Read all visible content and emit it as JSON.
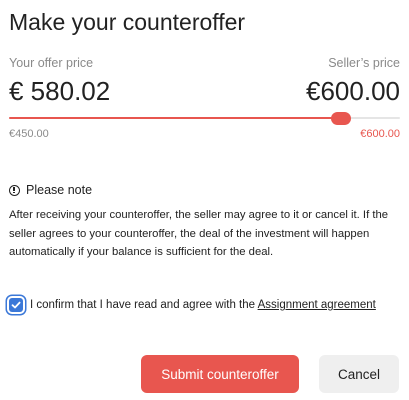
{
  "dialog": {
    "title": "Make your counteroffer"
  },
  "offer": {
    "your_label": "Your offer price",
    "your_value": "€ 580.02",
    "seller_label": "Seller’s price",
    "seller_value": "€600.00"
  },
  "slider": {
    "min_label": "€450.00",
    "max_label": "€600.00",
    "min": 450.0,
    "max": 600.0,
    "value": 580.02,
    "accent_color": "#e8564f"
  },
  "note": {
    "icon": "info-icon",
    "heading": "Please note",
    "text": "After receiving your counteroffer, the seller may agree to it or cancel it. If the seller agrees to your counteroffer, the deal of the investment will happen automatically if your balance is sufficient for the deal."
  },
  "confirm": {
    "checked": true,
    "text": "I confirm that I have read and agree with the ",
    "link": "Assignment agreement",
    "checkbox_color": "#3b78d8"
  },
  "actions": {
    "submit_label": "Submit counteroffer",
    "cancel_label": "Cancel"
  }
}
